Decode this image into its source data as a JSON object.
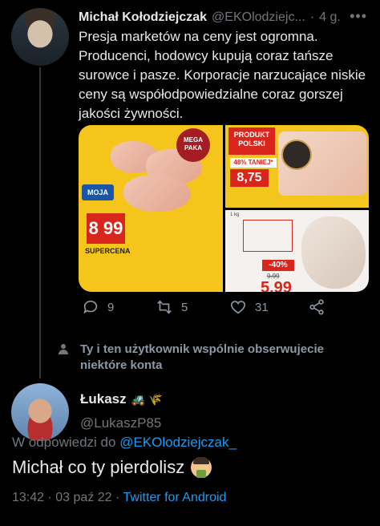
{
  "tweet": {
    "author_name": "Michał Kołodziejczak",
    "author_handle": "@EKOlodziejc...",
    "separator": "·",
    "time": "4 g.",
    "more": "•••",
    "text": "Presja marketów na ceny jest ogromna. Producenci, hodowcy kupują coraz tańsze surowce i pasze. Korporacje narzucające niskie ceny są współodpowiedzialne coraz gorszej jakości żywności.",
    "media": {
      "ad_a": {
        "badge": "MEGA PAKA",
        "brand": "MOJA",
        "price": "8 99",
        "label": "SUPERCENA"
      },
      "ad_b": {
        "tag": "PRODUKT POLSKI",
        "discount": "48% TANIEJ*",
        "price": "8,75"
      },
      "ad_c": {
        "weight": "1 kg",
        "discount": "-40%",
        "old_price": "9.99",
        "price": "5.99"
      }
    },
    "actions": {
      "replies": "9",
      "retweets": "5",
      "likes": "31"
    },
    "context": "Ty i ten użytkownik wspólnie obserwujecie niektóre konta"
  },
  "reply": {
    "author_name": "Łukasz",
    "author_emojis": "🚜 🌾",
    "author_handle": "@LukaszP85",
    "replying_prefix": "W odpowiedzi do",
    "replying_to": "@EKOlodziejczak_",
    "text": "Michał co ty pierdolisz",
    "time": "13:42",
    "dot": "·",
    "date": "03 paź 22",
    "dot2": "·",
    "client": "Twitter for Android"
  },
  "colors": {
    "background": "#000000",
    "text": "#e7e9ea",
    "muted": "#71767b",
    "link": "#1d9bf0"
  }
}
